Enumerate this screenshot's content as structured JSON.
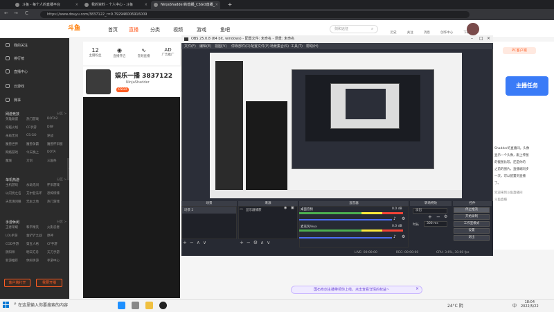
{
  "browser": {
    "tabs": [
      "斗鱼 - 每个人的直播平台",
      "我的资料 - 个人中心 - 斗鱼",
      "NinjaShadder的直播_CSGO直播_",
      ""
    ],
    "url": "https://www.douyu.com/3837122_r=9.792946006916009",
    "back": "←",
    "forward": "→",
    "reload": "C",
    "new_tab": "+"
  },
  "header": {
    "logo": "斗鱼",
    "nav": [
      "首页",
      "直播",
      "分类",
      "视频",
      "游戏",
      "鱼吧"
    ],
    "search_placeholder": "剑和远征",
    "icons": [
      "历史",
      "关注",
      "消息",
      "创作中心",
      "下载"
    ]
  },
  "room": {
    "counts": [
      "12",
      "",
      "",
      "AD"
    ],
    "count_labels": [
      "主播粉丝",
      "直播开启",
      "音频直播",
      "广告推广"
    ],
    "title": "娱乐一播 3837122",
    "streamer": "NinjaShadder",
    "tag": "CSGO",
    "promo_badge": "PC直播"
  },
  "sidebar": {
    "items": [
      "我的关注",
      "排行榜",
      "直播中心",
      "云游戏",
      "赛事"
    ],
    "sections": [
      {
        "title": "网游竞技",
        "more": "分区 >",
        "rows": [
          [
            "英雄联盟",
            "热门游戏",
            "DOTA2"
          ],
          [
            "穿越火线",
            "CF手游",
            "DNF"
          ],
          [
            "永劫无间",
            "CS:GO",
            "逆战"
          ],
          [
            "魔兽世界",
            "魔兽争霸",
            "魔兽怀旧服"
          ],
          [
            "网络游戏",
            "今天晚上",
            "DOTA"
          ],
          [
            "魔域",
            "刀剑",
            "三国杀"
          ]
        ]
      },
      {
        "title": "单机热游",
        "more": "分区 >",
        "rows": [
          [
            "主机游戏",
            "永劫无间",
            "怀旧游戏"
          ],
          [
            "以闪亮之名",
            "艾尔登法环",
            "恐怖惊悚"
          ],
          [
            "天黑请闭眼",
            "无主之地",
            "热门游戏"
          ]
        ]
      },
      {
        "title": "手游休闲",
        "more": "分区 >",
        "rows": [
          [
            "王者荣耀",
            "和平精英",
            "火影忍者"
          ],
          [
            "LOL手游",
            "金铲铲之战",
            "原神"
          ],
          [
            "COD手游",
            "第五人格",
            "CF手游"
          ],
          [
            "阴阳师",
            "明日方舟",
            "天刀手游"
          ],
          [
            "新游推荐",
            "休闲手游",
            "手游中心"
          ]
        ]
      }
    ],
    "btn_open": "客户端打开",
    "btn_stream": "我要开播",
    "collapse": "‹"
  },
  "obs": {
    "title": "OBS 25.0.8 (64 bit, windows) - 配置文件: 未命名 - 场景: 未命名",
    "menu": [
      "文件(F)",
      "编辑(E)",
      "视图(V)",
      "停靠部件(D)",
      "配置文件(P)",
      "场景集合(S)",
      "工具(T)",
      "帮助(H)"
    ],
    "docks": [
      "场景",
      "来源",
      "混音器",
      "转场特效",
      "控件"
    ],
    "scene": "场景 2",
    "source": "显示器捕获",
    "mixer": [
      {
        "name": "桌面音频",
        "db": "0.0 dB"
      },
      {
        "name": "麦克风/Aux",
        "db": "0.0 dB"
      }
    ],
    "transition": "淡出",
    "duration_label": "时长",
    "duration": "300 ms",
    "controls": [
      "停止推流",
      "开始录制",
      "工作室模式",
      "设置",
      "退出"
    ],
    "status": [
      "LIVE: 00:00:00",
      "REC: 00:00:00",
      "CPU: 3.6%, 30.00 fps"
    ]
  },
  "right_panel": {
    "badge": "PC客户端",
    "lines": [
      "Shadder的直播间。头像",
      "显示一个头像，跟上传图",
      "的截图比较，还是你的",
      "之前的图片，直播端同步",
      "一次，可以配置到直播",
      "了。"
    ],
    "promo": "主播任务",
    "sub": [
      "欢迎来到斗鱼直播间",
      "斗鱼直播"
    ]
  },
  "notification": "国石布创主播带领你上线，点击查看详情的权益~",
  "taskbar": {
    "search": "在这里输入你要搜索的内容",
    "weather": "24°C 阴",
    "time": "18:04",
    "date": "2022/5/22",
    "lang": "中"
  }
}
